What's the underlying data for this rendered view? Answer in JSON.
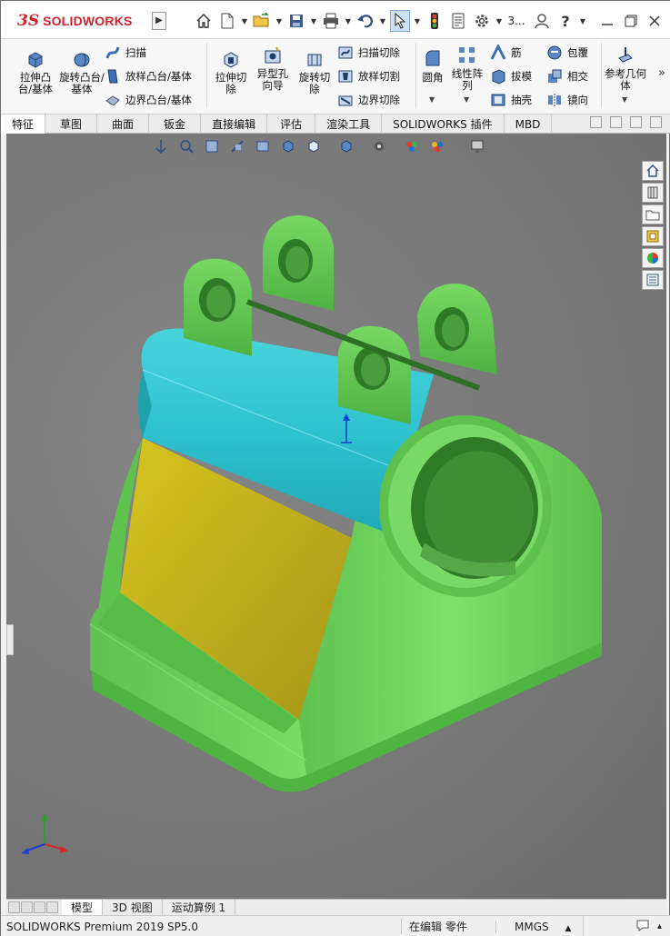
{
  "app": {
    "logo_ds": "3S",
    "logo_text": "SOLIDWORKS"
  },
  "quick_access": {
    "more_label": "3..."
  },
  "ribbon": {
    "extrude_boss": "拉伸凸台/基体",
    "revolve_boss": "旋转凸台/基体",
    "sweep": "扫描",
    "loft_boss": "放样凸台/基体",
    "boundary_boss": "边界凸台/基体",
    "extrude_cut": "拉伸切除",
    "hole_wizard": "异型孔向导",
    "revolve_cut": "旋转切除",
    "swept_cut": "扫描切除",
    "lofted_cut": "放样切割",
    "boundary_cut": "边界切除",
    "fillet": "圆角",
    "linear_pattern": "线性阵列",
    "rib": "筋",
    "draft": "拔模",
    "shell": "抽壳",
    "wrap": "包覆",
    "intersect": "相交",
    "mirror": "镜向",
    "ref_geometry": "参考几何体"
  },
  "tabs": [
    "特征",
    "草图",
    "曲面",
    "钣金",
    "直接编辑",
    "评估",
    "渲染工具",
    "SOLIDWORKS 插件",
    "MBD"
  ],
  "doc_tabs": [
    "模型",
    "3D 视图",
    "运动算例 1"
  ],
  "status": {
    "product": "SOLIDWORKS Premium 2019 SP5.0",
    "editing": "在编辑 零件",
    "units": "MMGS"
  },
  "colors": {
    "model_green": "#6cd15a",
    "model_cyan": "#2ec3cf",
    "model_yellow": "#c9b81f",
    "brand_red": "#d2232a"
  }
}
